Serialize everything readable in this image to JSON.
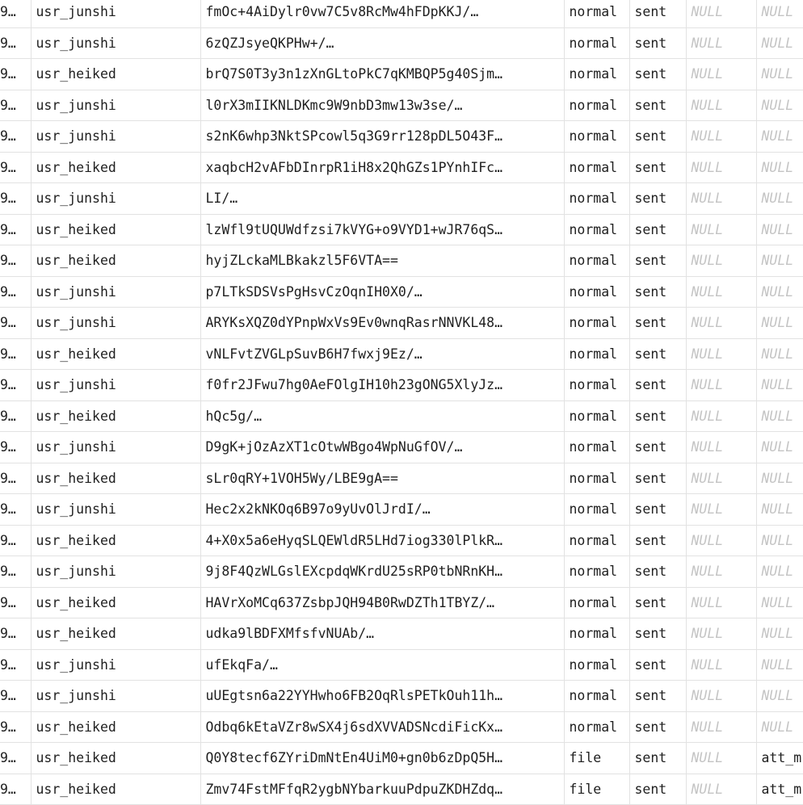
{
  "null_label": "NULL",
  "colors": {
    "grid_line": "#e2e2e2",
    "null_text": "#c4c4c4",
    "text": "#1f1f1f"
  },
  "rows": [
    {
      "id": "9…",
      "sender": "usr_junshi",
      "content": "fmOc+4AiDylr0vw7C5v8RcMw4hFDpKKJ/…",
      "type": "normal",
      "status": "sent",
      "col6": "NULL",
      "col7": "NULL"
    },
    {
      "id": "9…",
      "sender": "usr_junshi",
      "content": "6zQZJsyeQKPHw+/…",
      "type": "normal",
      "status": "sent",
      "col6": "NULL",
      "col7": "NULL"
    },
    {
      "id": "9…",
      "sender": "usr_heiked",
      "content": "brQ7S0T3y3n1zXnGLtoPkC7qKMBQP5g40Sjm…",
      "type": "normal",
      "status": "sent",
      "col6": "NULL",
      "col7": "NULL"
    },
    {
      "id": "9…",
      "sender": "usr_junshi",
      "content": "l0rX3mIIKNLDKmc9W9nbD3mw13w3se/…",
      "type": "normal",
      "status": "sent",
      "col6": "NULL",
      "col7": "NULL"
    },
    {
      "id": "9…",
      "sender": "usr_junshi",
      "content": "s2nK6whp3NktSPcowl5q3G9rr128pDL5O43F…",
      "type": "normal",
      "status": "sent",
      "col6": "NULL",
      "col7": "NULL"
    },
    {
      "id": "9…",
      "sender": "usr_heiked",
      "content": "xaqbcH2vAFbDInrpR1iH8x2QhGZs1PYnhIFc…",
      "type": "normal",
      "status": "sent",
      "col6": "NULL",
      "col7": "NULL"
    },
    {
      "id": "9…",
      "sender": "usr_junshi",
      "content": "LI/…",
      "type": "normal",
      "status": "sent",
      "col6": "NULL",
      "col7": "NULL"
    },
    {
      "id": "9…",
      "sender": "usr_heiked",
      "content": "lzWfl9tUQUWdfzsi7kVYG+o9VYD1+wJR76qS…",
      "type": "normal",
      "status": "sent",
      "col6": "NULL",
      "col7": "NULL"
    },
    {
      "id": "9…",
      "sender": "usr_heiked",
      "content": "hyjZLckaMLBkakzl5F6VTA==",
      "type": "normal",
      "status": "sent",
      "col6": "NULL",
      "col7": "NULL"
    },
    {
      "id": "9…",
      "sender": "usr_junshi",
      "content": "p7LTkSDSVsPgHsvCzOqnIH0X0/…",
      "type": "normal",
      "status": "sent",
      "col6": "NULL",
      "col7": "NULL"
    },
    {
      "id": "9…",
      "sender": "usr_junshi",
      "content": "ARYKsXQZ0dYPnpWxVs9Ev0wnqRasrNNVKL48…",
      "type": "normal",
      "status": "sent",
      "col6": "NULL",
      "col7": "NULL"
    },
    {
      "id": "9…",
      "sender": "usr_heiked",
      "content": "vNLFvtZVGLpSuvB6H7fwxj9Ez/…",
      "type": "normal",
      "status": "sent",
      "col6": "NULL",
      "col7": "NULL"
    },
    {
      "id": "9…",
      "sender": "usr_junshi",
      "content": "f0fr2JFwu7hg0AeFOlgIH10h23gONG5XlyJz…",
      "type": "normal",
      "status": "sent",
      "col6": "NULL",
      "col7": "NULL"
    },
    {
      "id": "9…",
      "sender": "usr_heiked",
      "content": "hQc5g/…",
      "type": "normal",
      "status": "sent",
      "col6": "NULL",
      "col7": "NULL"
    },
    {
      "id": "9…",
      "sender": "usr_junshi",
      "content": "D9gK+jOzAzXT1cOtwWBgo4WpNuGfOV/…",
      "type": "normal",
      "status": "sent",
      "col6": "NULL",
      "col7": "NULL"
    },
    {
      "id": "9…",
      "sender": "usr_heiked",
      "content": "sLr0qRY+1VOH5Wy/LBE9gA==",
      "type": "normal",
      "status": "sent",
      "col6": "NULL",
      "col7": "NULL"
    },
    {
      "id": "9…",
      "sender": "usr_junshi",
      "content": "Hec2x2kNKOq6B97o9yUvOlJrdI/…",
      "type": "normal",
      "status": "sent",
      "col6": "NULL",
      "col7": "NULL"
    },
    {
      "id": "9…",
      "sender": "usr_heiked",
      "content": "4+X0x5a6eHyqSLQEWldR5LHd7iog330lPlkR…",
      "type": "normal",
      "status": "sent",
      "col6": "NULL",
      "col7": "NULL"
    },
    {
      "id": "9…",
      "sender": "usr_junshi",
      "content": "9j8F4QzWLGslEXcpdqWKrdU25sRP0tbNRnKH…",
      "type": "normal",
      "status": "sent",
      "col6": "NULL",
      "col7": "NULL"
    },
    {
      "id": "9…",
      "sender": "usr_heiked",
      "content": "HAVrXoMCq637ZsbpJQH94B0RwDZTh1TBYZ/…",
      "type": "normal",
      "status": "sent",
      "col6": "NULL",
      "col7": "NULL"
    },
    {
      "id": "9…",
      "sender": "usr_heiked",
      "content": "udka9lBDFXMfsfvNUAb/…",
      "type": "normal",
      "status": "sent",
      "col6": "NULL",
      "col7": "NULL"
    },
    {
      "id": "9…",
      "sender": "usr_junshi",
      "content": "ufEkqFa/…",
      "type": "normal",
      "status": "sent",
      "col6": "NULL",
      "col7": "NULL"
    },
    {
      "id": "9…",
      "sender": "usr_junshi",
      "content": "uUEgtsn6a22YYHwho6FB2OqRlsPETkOuh11h…",
      "type": "normal",
      "status": "sent",
      "col6": "NULL",
      "col7": "NULL"
    },
    {
      "id": "9…",
      "sender": "usr_heiked",
      "content": "Odbq6kEtaVZr8wSX4j6sdXVVADSNcdiFicKx…",
      "type": "normal",
      "status": "sent",
      "col6": "NULL",
      "col7": "NULL"
    },
    {
      "id": "9…",
      "sender": "usr_heiked",
      "content": "Q0Y8tecf6ZYriDmNtEn4UiM0+gn0b6zDpQ5H…",
      "type": "file",
      "status": "sent",
      "col6": "NULL",
      "col7": "att_m"
    },
    {
      "id": "9…",
      "sender": "usr_heiked",
      "content": "Zmv74FstMFfqR2ygbNYbarkuuPdpuZKDHZdq…",
      "type": "file",
      "status": "sent",
      "col6": "NULL",
      "col7": "att_m"
    }
  ]
}
